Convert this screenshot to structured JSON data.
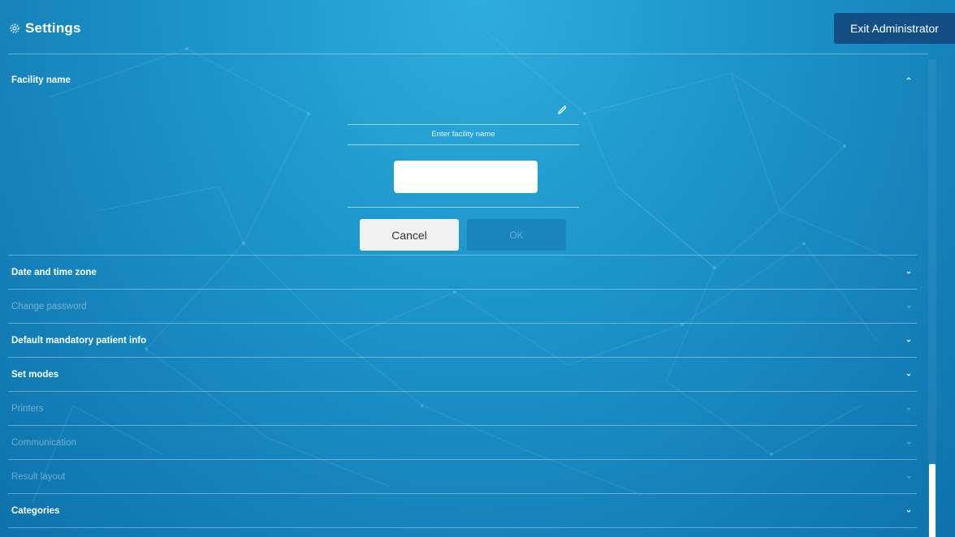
{
  "header": {
    "title": "Settings",
    "exit_label": "Exit Administrator"
  },
  "facility": {
    "label": "Facility name",
    "prompt": "Enter facility name",
    "input_value": "",
    "input_placeholder": "",
    "cancel_label": "Cancel",
    "ok_label": "OK"
  },
  "sections": [
    {
      "label": "Date and time zone",
      "enabled": true
    },
    {
      "label": "Change password",
      "enabled": false
    },
    {
      "label": "Default mandatory patient info",
      "enabled": true
    },
    {
      "label": "Set modes",
      "enabled": true
    },
    {
      "label": "Printers",
      "enabled": false
    },
    {
      "label": "Communication",
      "enabled": false
    },
    {
      "label": "Result layout",
      "enabled": false
    },
    {
      "label": "Categories",
      "enabled": true
    }
  ],
  "icons": {
    "title": "gear-icon",
    "edit": "pencil-icon",
    "expanded": "chevron-up-icon",
    "collapsed": "chevron-down-icon"
  },
  "colors": {
    "background": "#1d95cb",
    "exit_button": "#134e85",
    "ok_button_disabled": "#1a84bd",
    "cancel_button": "#f1f1f1"
  }
}
